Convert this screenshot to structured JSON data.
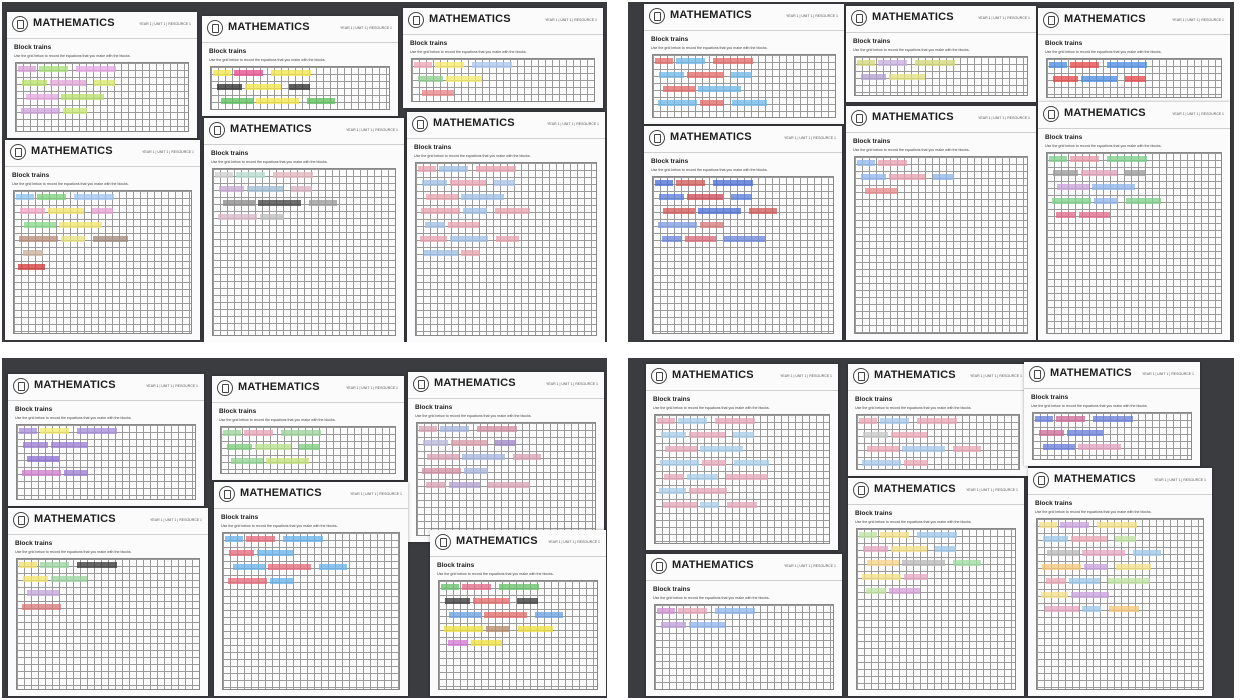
{
  "worksheet": {
    "header_title": "MATHEMATICS",
    "year_unit_text": "YEAR 1 | UNIT 1 | RESOURCE 1",
    "subtitle": "Block trains",
    "instruction": "Use the grid below to record the equations that you make with the blocks."
  },
  "photos": [
    {
      "sheets": [
        {
          "bars": [
            [
              "#d9a0d6",
              "#a9e07a",
              "#e7a8e6"
            ],
            [
              "#b8e06a",
              "#e3a6d6",
              "#d8e86d"
            ],
            [
              "#e6a6e0",
              "#b7df6a"
            ],
            [
              "#d0a2dc",
              "#c7e772"
            ]
          ]
        },
        {
          "bars": [
            [
              "#f2e54b",
              "#e84a8d",
              "#f2e54b"
            ],
            [
              "#2f2f2f",
              "#f2e54b",
              "#2f2f2f"
            ],
            [
              "#5cbf5c",
              "#f2e54b",
              "#5cbf5c"
            ]
          ]
        },
        {
          "bars": [
            [
              "#f0a7b8",
              "#f6e96a",
              "#a9c7ef"
            ],
            [
              "#8fd08f",
              "#f6ec6f"
            ],
            [
              "#e8878a"
            ]
          ]
        },
        {
          "bars": [
            [
              "#8ec4ef",
              "#7ed17e",
              "#a2c7f3"
            ],
            [
              "#f0a6c4",
              "#f2e26a",
              "#e6a3d6"
            ],
            [
              "#88d88a",
              "#f1e56b"
            ],
            [
              "#b88e7b",
              "#e9e083",
              "#a38b7b"
            ],
            [
              "#c8b2a0"
            ],
            [
              "#d23b3b"
            ]
          ]
        },
        {
          "bars": [
            [
              "#cfcfcf",
              "#b7dccf",
              "#e3b6bc"
            ],
            [
              "#c7a8d1",
              "#9fbdd4",
              "#d8b4c3"
            ],
            [
              "#8b8b8b",
              "#444444",
              "#9a9a9a"
            ],
            [
              "#d9b7c8",
              "#bcbcbc"
            ]
          ]
        },
        {
          "bars": [
            [
              "#e7a3b0",
              "#9fbfe6",
              "#e7a3b0"
            ],
            [
              "#9fbfe6",
              "#e7a3b0",
              "#a9c3e9"
            ],
            [
              "#e7a3b0",
              "#9fbfe6"
            ],
            [
              "#e7a3b0",
              "#9fbfe6",
              "#e7a3b0"
            ],
            [
              "#9fbfe6",
              "#e7a3b0"
            ],
            [
              "#e7a3b0",
              "#9fbfe6",
              "#e7a3b0"
            ],
            [
              "#9fbfe6",
              "#e7a3b0"
            ]
          ]
        }
      ]
    },
    {
      "sheets": [
        {
          "bars": [
            [
              "#e06a6a",
              "#71b7e8",
              "#e06a6a"
            ],
            [
              "#71b7e8",
              "#e06a6a",
              "#71b7e8"
            ],
            [
              "#e06a6a",
              "#71b7e8"
            ],
            [
              "#71b7e8",
              "#e06a6a",
              "#71b7e8"
            ],
            [
              "#e06a6a",
              "#71b7e8",
              "#e06a6a"
            ],
            [
              "#71b7e8",
              "#e06a6a"
            ]
          ]
        },
        {
          "bars": [
            [
              "#d3d97a",
              "#c9b0df",
              "#d3d97a"
            ],
            [
              "#b0a0cf",
              "#e2e07f"
            ]
          ]
        },
        {
          "bars": [
            [
              "#4d8de2",
              "#e44a4a",
              "#4d8de2"
            ],
            [
              "#e44a4a",
              "#4d8de2",
              "#e44a4a"
            ]
          ]
        },
        {
          "bars": [
            [
              "#4b6fd3",
              "#d05a5a",
              "#4b6fd3"
            ],
            [
              "#5b7fd8",
              "#cc4a5a",
              "#5b7fd8"
            ],
            [
              "#d05a5a",
              "#4b6fd3",
              "#d05a5a"
            ],
            [
              "#7f9ee0",
              "#d77a7a"
            ],
            [
              "#6a86d8",
              "#d76a7a",
              "#6a86d8"
            ]
          ]
        },
        {
          "bars": [
            [
              "#8fb6ea",
              "#e8a0b0"
            ],
            [
              "#8fb6ea",
              "#e8a0b0",
              "#8fb6ea"
            ],
            [
              "#e88a8a"
            ]
          ]
        },
        {
          "bars": [
            [
              "#7fd08a",
              "#e89aa6",
              "#7fd08a"
            ],
            [
              "#9a9a9a",
              "#e3a0b8",
              "#9a9a9a"
            ],
            [
              "#c6a2da",
              "#8fb5ea"
            ],
            [
              "#7fd08a",
              "#8fb5ea",
              "#7fd08a"
            ],
            [
              "#e06a8a",
              "#e06a8a"
            ]
          ]
        }
      ]
    },
    {
      "sheets": [
        {
          "bars": [
            [
              "#a78ed9",
              "#f3ea6f",
              "#a78ed9"
            ],
            [
              "#9a7ed2",
              "#9a7ed2"
            ],
            [
              "#8b6fcf"
            ],
            [
              "#d07ecc",
              "#9a7ed2"
            ]
          ]
        },
        {
          "bars": [
            [
              "#9bd49b",
              "#e7a3b6",
              "#9bd49b"
            ],
            [
              "#7ccd7c",
              "#b7e28b",
              "#7ccd7c"
            ],
            [
              "#8fd28f",
              "#c2e07a"
            ],
            [
              "#e7a3b6",
              "#9bd49b"
            ]
          ]
        },
        {
          "bars": [
            [
              "#d7a0b4",
              "#a7b4dc",
              "#cf8fa3"
            ],
            [
              "#b7b7d9",
              "#d79aa8",
              "#9e86c6"
            ],
            [
              "#d7a0b4",
              "#a7b4dc",
              "#d7a0b4"
            ],
            [
              "#cf8fa3",
              "#a7b4dc"
            ],
            [
              "#d7a0b4",
              "#b0a0d0",
              "#d7a0b4"
            ]
          ]
        },
        {
          "bars": [
            [
              "#f0e06a",
              "#9ed4a0",
              "#3a3a3a"
            ],
            [
              "#f2e56b",
              "#9ed4a0"
            ],
            [
              "#c3a7dd"
            ],
            [
              "#d77a7a"
            ]
          ]
        },
        {
          "bars": [
            [
              "#6ab2ea",
              "#e66a7a",
              "#6ab2ea"
            ],
            [
              "#e66a7a",
              "#6ab2ea"
            ],
            [
              "#6ab2ea",
              "#e66a7a",
              "#6ab2ea"
            ],
            [
              "#e66a7a",
              "#6ab2ea"
            ]
          ]
        },
        {
          "bars": [
            [
              "#68c06a",
              "#e46a8a",
              "#68c06a"
            ],
            [
              "#3a3a3a",
              "#e46a6a",
              "#3a3a3a"
            ],
            [
              "#6aa2e0",
              "#e46a6a",
              "#6aa2e0"
            ],
            [
              "#f0e040",
              "#b58a6a",
              "#f0e040"
            ],
            [
              "#d57ad5",
              "#f0e040"
            ]
          ]
        }
      ]
    },
    {
      "sheets": [
        {
          "bars": [
            [
              "#e6a6b8",
              "#a8cdea",
              "#e6a6b8"
            ],
            [
              "#a8cdea",
              "#e6a6b8",
              "#a8cdea"
            ],
            [
              "#e6a6b8",
              "#a8cdea"
            ],
            [
              "#a8cdea",
              "#e6a6b8",
              "#a8cdea"
            ],
            [
              "#e6a6b8",
              "#a8cdea",
              "#e6a6b8"
            ],
            [
              "#a8cdea",
              "#e6a6b8"
            ],
            [
              "#e6a6b8",
              "#a8cdea",
              "#e6a6b8"
            ]
          ]
        },
        {
          "bars": [
            [
              "#e8a6b6",
              "#a6c7ea",
              "#e8a6b6"
            ],
            [
              "#c8c8c8",
              "#e8a6b6"
            ],
            [
              "#e8a6b6",
              "#a6c7ea",
              "#e8a6b6"
            ],
            [
              "#a6c7ea",
              "#e8a6b6"
            ]
          ]
        },
        {
          "bars": [
            [
              "#6a7fd8",
              "#d06a9a",
              "#6a7fd8"
            ],
            [
              "#d06a9a",
              "#6a7fd8"
            ],
            [
              "#6a7fd8",
              "#e0a0c0"
            ]
          ]
        },
        {
          "bars": [
            [
              "#d08fd0",
              "#e6a6b6",
              "#8fb6ea"
            ],
            [
              "#c0a0d8",
              "#8fb6ea"
            ]
          ]
        },
        {
          "bars": [
            [
              "#bfe3a0",
              "#f2e086",
              "#9fc6ea"
            ],
            [
              "#e6a6c0",
              "#f2e086",
              "#9fc6ea"
            ],
            [
              "#f5d28a",
              "#b9b9b9",
              "#9fdca0"
            ],
            [
              "#f2e086",
              "#e6a6c0"
            ],
            [
              "#bfe3a0",
              "#d8a0d8"
            ]
          ]
        },
        {
          "bars": [
            [
              "#f2e086",
              "#c9a0dd",
              "#f2e086"
            ],
            [
              "#9fc6ea",
              "#e8a6b6",
              "#bfe3a0"
            ],
            [
              "#b9b9b9",
              "#e6a6c0",
              "#9fc6ea"
            ],
            [
              "#f5c77a",
              "#c9a0dd",
              "#f2e086"
            ],
            [
              "#e8a6b6",
              "#9fc6ea",
              "#bfe3a0"
            ],
            [
              "#f2e086",
              "#c9a0dd"
            ],
            [
              "#e6a6c0",
              "#9fc6ea",
              "#f5c77a"
            ]
          ]
        }
      ]
    }
  ]
}
